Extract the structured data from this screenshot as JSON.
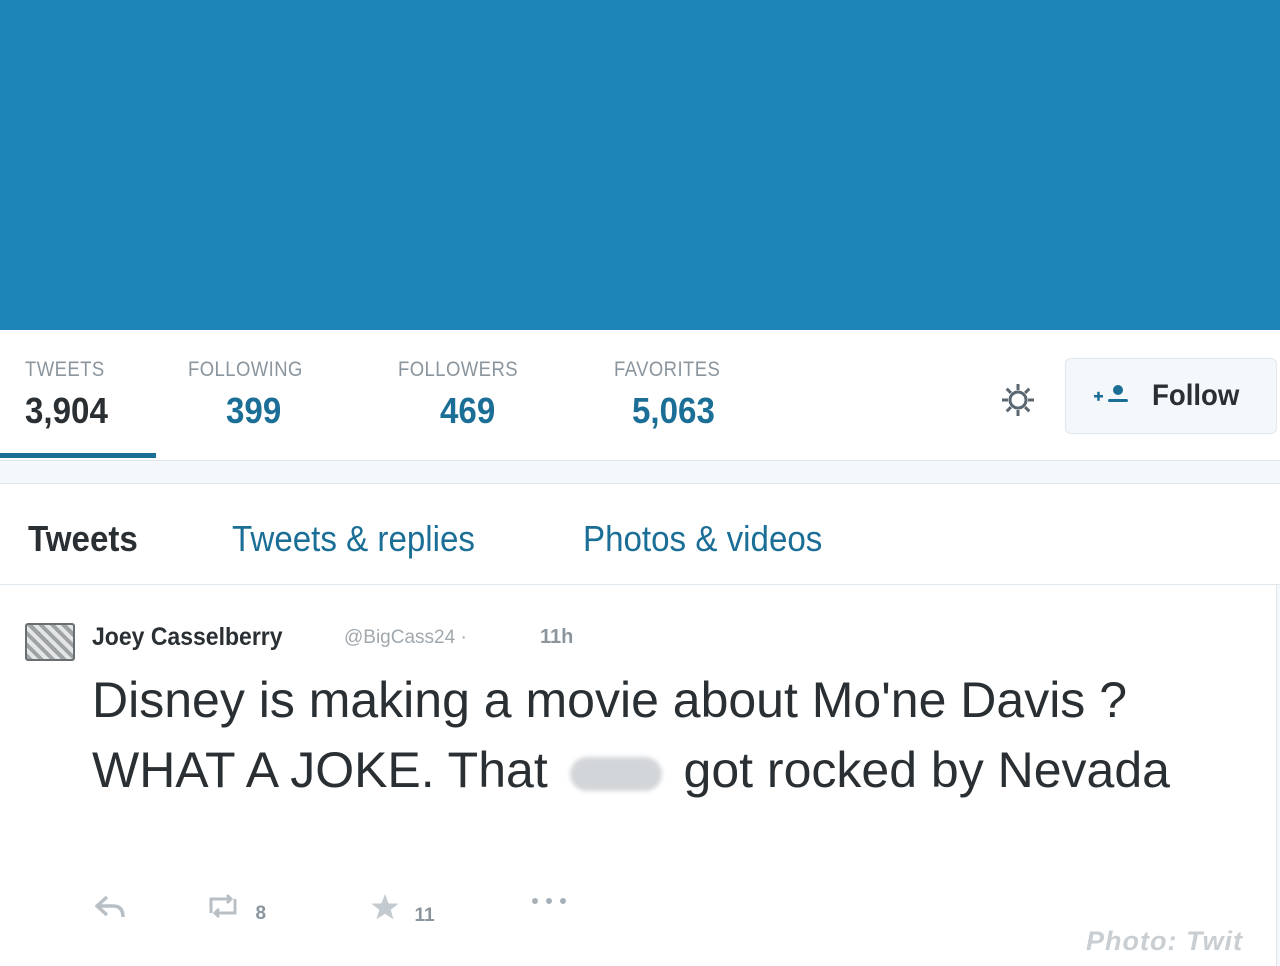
{
  "profile": {
    "stats": [
      {
        "label": "TWEETS",
        "value": "3,904"
      },
      {
        "label": "FOLLOWING",
        "value": "399"
      },
      {
        "label": "FOLLOWERS",
        "value": "469"
      },
      {
        "label": "FAVORITES",
        "value": "5,063"
      }
    ],
    "follow_label": "Follow",
    "accent_color": "#1b6e96",
    "banner_color": "#1d85b8"
  },
  "tabs": [
    {
      "label": "Tweets",
      "active": true
    },
    {
      "label": "Tweets & replies",
      "active": false
    },
    {
      "label": "Photos & videos",
      "active": false
    }
  ],
  "tweet": {
    "name": "Joey Casselberry",
    "handle": "@BigCass24",
    "separator": "·",
    "time": "11h",
    "text_part1": "Disney is making a movie about Mo'ne Davis ? WHAT A JOKE. That",
    "text_part2": "got rocked by Nevada",
    "retweets": "8",
    "favorites": "11",
    "icons": [
      "reply-icon",
      "retweet-icon",
      "favorite-star-icon",
      "more-icon"
    ]
  },
  "watermark": "Photo: Twit"
}
